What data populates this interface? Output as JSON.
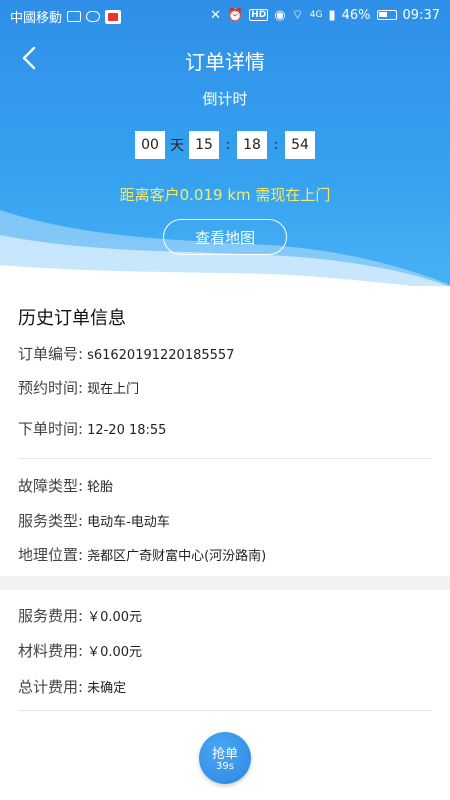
{
  "status_bar": {
    "carrier": "中國移動",
    "battery": "46%",
    "time": "09:37",
    "hd": "HD",
    "signal": "4G"
  },
  "header": {
    "title": "订单详情",
    "countdown_label": "倒计时",
    "timer": {
      "days": "00",
      "day_unit": "天",
      "hours": "15",
      "minutes": "18",
      "seconds": "54",
      "sep": ":"
    },
    "distance_text": "距离客户0.019 km 需现在上门",
    "map_button": "查看地图"
  },
  "order": {
    "section_title": "历史订单信息",
    "fields": [
      {
        "label": "订单编号:",
        "value": "s61620191220185557"
      },
      {
        "label": "预约时间:",
        "value": "现在上门"
      },
      {
        "label": "下单时间:",
        "value": "12-20 18:55"
      },
      {
        "label": "故障类型:",
        "value": "轮胎"
      },
      {
        "label": "服务类型:",
        "value": "电动车-电动车"
      },
      {
        "label": "地理位置:",
        "value": "尧都区广奇财富中心(河汾路南)"
      }
    ]
  },
  "fees": [
    {
      "label": "服务费用:",
      "value": "￥0.00元"
    },
    {
      "label": "材料费用:",
      "value": "￥0.00元"
    },
    {
      "label": "总计费用:",
      "value": "未确定"
    }
  ],
  "grab_button": {
    "label": "抢单",
    "countdown": "39s"
  },
  "colors": {
    "header_blue": "#2f8fe8",
    "distance_yellow": "#f6ec6a",
    "button_blue": "#2a86e3"
  }
}
